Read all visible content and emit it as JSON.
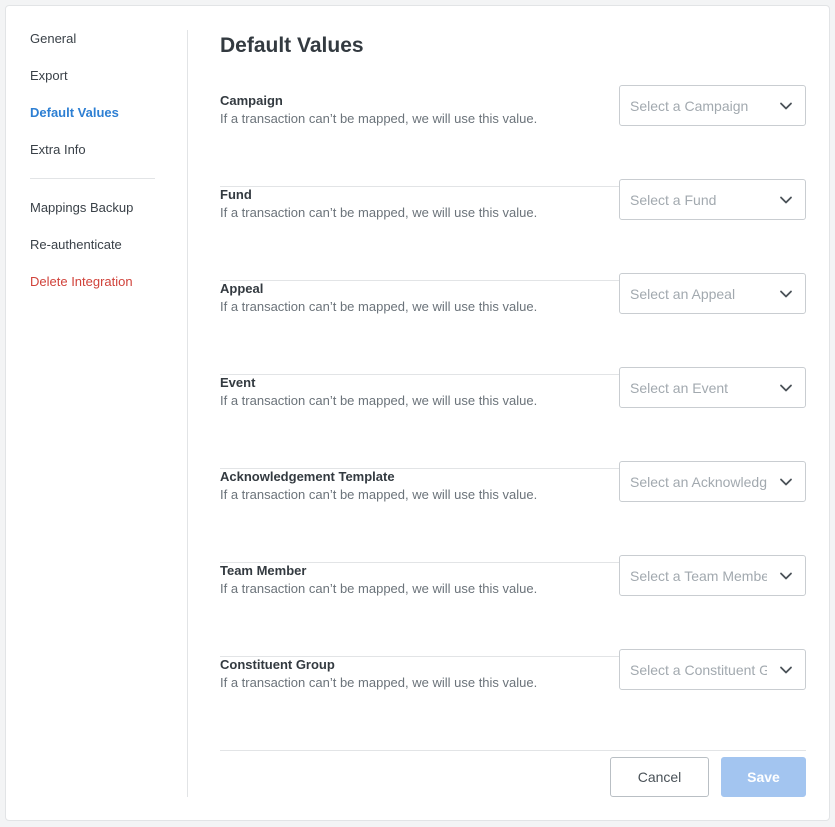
{
  "sidebar": {
    "items": [
      {
        "label": "General"
      },
      {
        "label": "Export"
      },
      {
        "label": "Default Values"
      },
      {
        "label": "Extra Info"
      },
      {
        "label": "Mappings Backup"
      },
      {
        "label": "Re-authenticate"
      },
      {
        "label": "Delete Integration"
      }
    ]
  },
  "page": {
    "title": "Default Values"
  },
  "fields": [
    {
      "label": "Campaign",
      "help": "If a transaction can’t be mapped, we will use this value.",
      "placeholder": "Select a Campaign"
    },
    {
      "label": "Fund",
      "help": "If a transaction can’t be mapped, we will use this value.",
      "placeholder": "Select a Fund"
    },
    {
      "label": "Appeal",
      "help": "If a transaction can’t be mapped, we will use this value.",
      "placeholder": "Select an Appeal"
    },
    {
      "label": "Event",
      "help": "If a transaction can’t be mapped, we will use this value.",
      "placeholder": "Select an Event"
    },
    {
      "label": "Acknowledgement Template",
      "help": "If a transaction can’t be mapped, we will use this value.",
      "placeholder": "Select an Acknowledgement Template"
    },
    {
      "label": "Team Member",
      "help": "If a transaction can’t be mapped, we will use this value.",
      "placeholder": "Select a Team Member"
    },
    {
      "label": "Constituent Group",
      "help": "If a transaction can’t be mapped, we will use this value.",
      "placeholder": "Select a Constituent Group"
    }
  ],
  "actions": {
    "cancel_label": "Cancel",
    "save_label": "Save"
  },
  "colors": {
    "accent": "#2d7fd3",
    "danger": "#d0423a",
    "save_disabled": "#a3c5f0"
  }
}
